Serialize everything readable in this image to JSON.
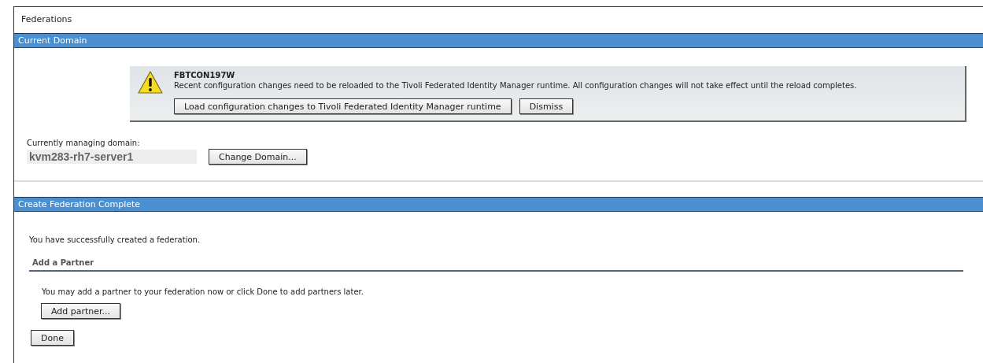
{
  "page_title": "Federations",
  "current_domain": {
    "header": "Current Domain",
    "warning": {
      "code": "FBTCON197W",
      "message": "Recent configuration changes need to be reloaded to the Tivoli Federated Identity Manager runtime. All configuration changes will not take effect until the reload completes.",
      "buttons": [
        "Load configuration changes to Tivoli Federated Identity Manager runtime",
        "Dismiss"
      ]
    },
    "domain_label": "Currently managing domain:",
    "domain_value": "kvm283-rh7-server1",
    "change_button": "Change Domain..."
  },
  "complete": {
    "header": "Create Federation Complete",
    "message": "You have successfully created a federation.",
    "partner": {
      "title": "Add a Partner",
      "text": "You may add a partner to your federation now or click Done to add partners later.",
      "button": "Add partner..."
    },
    "done_button": "Done"
  }
}
